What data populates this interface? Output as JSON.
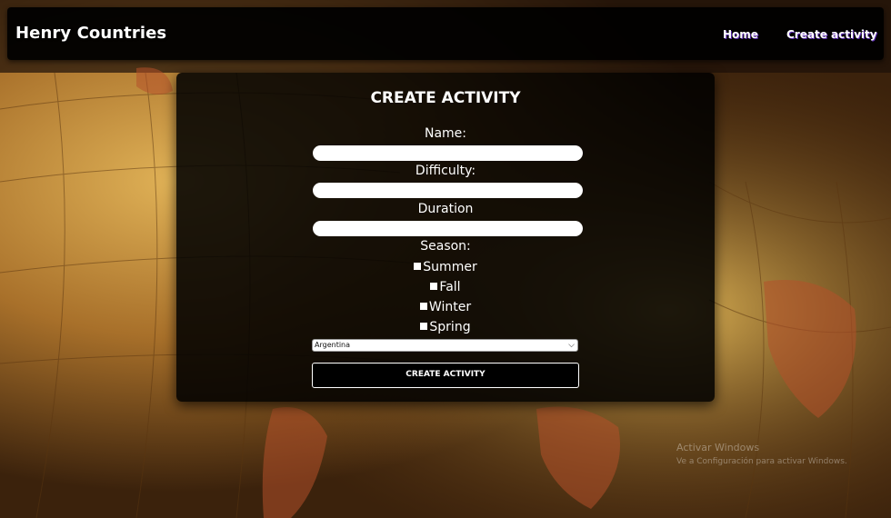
{
  "navbar": {
    "brand": "Henry Countries",
    "links": [
      "Home",
      "Create activity"
    ]
  },
  "form": {
    "title": "CREATE ACTIVITY",
    "name_label": "Name:",
    "difficulty_label": "Difficulty:",
    "duration_label": "Duration",
    "season_label": "Season:",
    "seasons": [
      "Summer",
      "Fall",
      "Winter",
      "Spring"
    ],
    "country_select_value": "Argentina",
    "submit_label": "CREATE ACTIVITY"
  },
  "watermark": {
    "line1": "Activar Windows",
    "line2": "Ve a Configuración para activar Windows."
  },
  "colors": {
    "navbar_bg": "#000000",
    "card_bg": "#000000",
    "nav_link_shadow": "#5b2bb0"
  }
}
